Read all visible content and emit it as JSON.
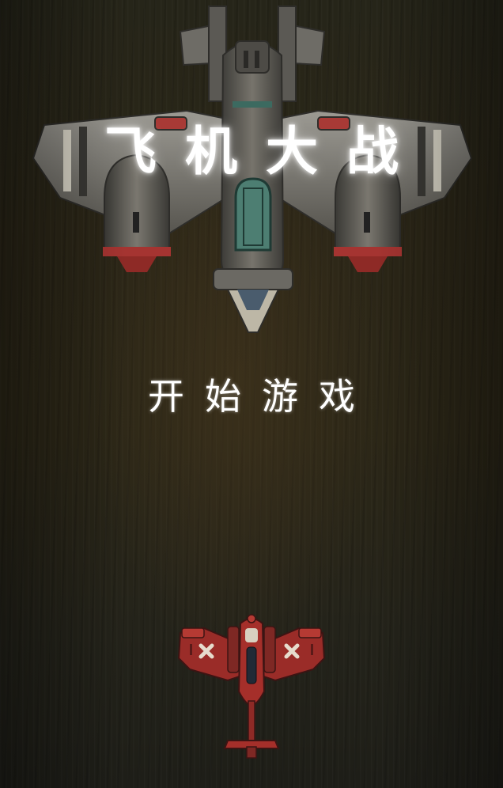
{
  "game": {
    "title": "飞机大战",
    "start_label": "开始游戏"
  },
  "sprites": {
    "boss": "enemy-boss-plane",
    "player": "player-plane"
  },
  "colors": {
    "background": "#2a2618",
    "title_text": "#ffffff",
    "boss_body": "#5d5b55",
    "player_body": "#8e2a26"
  }
}
